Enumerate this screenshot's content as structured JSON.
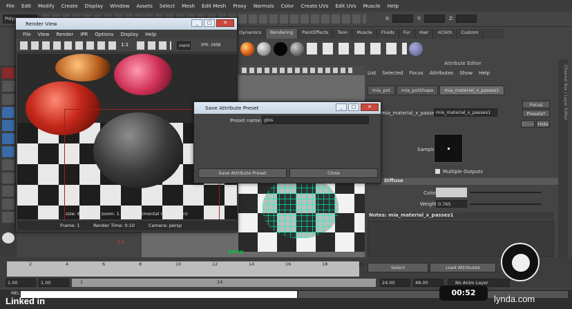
{
  "menu": [
    "File",
    "Edit",
    "Modify",
    "Create",
    "Display",
    "Window",
    "Assets",
    "Select",
    "Mesh",
    "Edit Mesh",
    "Proxy",
    "Normals",
    "Color",
    "Create UVs",
    "Edit UVs",
    "Muscle",
    "Help"
  ],
  "status": {
    "mode": "Polygons",
    "x_label": "X:",
    "y_label": "Y:",
    "z_label": "Z:"
  },
  "shelf_tabs": [
    "Dynamics",
    "Rendering",
    "PaintEffects",
    "Toon",
    "Muscle",
    "Fluids",
    "Fur",
    "Hair",
    "nCloth",
    "Custom"
  ],
  "shelf_active": "Rendering",
  "viewport_label": "persp",
  "render_view": {
    "title": "Render View",
    "menu": [
      "File",
      "View",
      "Render",
      "IPR",
      "Options",
      "Display",
      "Help"
    ],
    "ratio": "1:1",
    "layer_btn": "ment",
    "ipr_text": "IPR: 0MB",
    "info": "size: 640 x 480  zoom: 1.030",
    "renderer": "(mental ray, Region)",
    "frame": "Frame: 1",
    "time": "Render Time: 0:10",
    "camera": "Camera: persp"
  },
  "dialog": {
    "title": "Save Attribute Preset",
    "label": "Preset name:",
    "value": "glos",
    "save": "Save Attribute Preset",
    "close": "Close"
  },
  "attr_editor": {
    "title": "Attribute Editor",
    "menu": [
      "List",
      "Selected",
      "Focus",
      "Attributes",
      "Show",
      "Help"
    ],
    "tabs": [
      "mia_pot",
      "mia_potShape",
      "mia_material_x_passes1"
    ],
    "node_label": "mia_material_x_passes:",
    "node_value": "mia_material_x_passes1",
    "focus": "Focus",
    "presets": "Presets*",
    "show": "Show",
    "hide": "Hide",
    "sample": "Sample",
    "multiple": "Multiple Outputs",
    "diffuse": "Diffuse",
    "color": "Color",
    "weight_label": "Weight",
    "weight": "0.765",
    "notes": "Notes:  mia_material_x_passes1",
    "select": "Select",
    "load": "Load Attributes",
    "side_tabs": [
      "Channel Box / Layer Editor",
      "Attribute Editor"
    ]
  },
  "timeline": {
    "ticks": [
      "2",
      "4",
      "6",
      "8",
      "10",
      "12",
      "14",
      "16",
      "18",
      "20"
    ],
    "range_start": "1.00",
    "range_start2": "1.00",
    "cur": "1",
    "mid": "24",
    "end1": "24.00",
    "end2": "48.00",
    "anim_layer": "No Anim Layer"
  },
  "cmd": {
    "mel": "MEL",
    "time": "00:52"
  },
  "brand": {
    "left": "Linked in",
    "right": "lynda.com"
  }
}
